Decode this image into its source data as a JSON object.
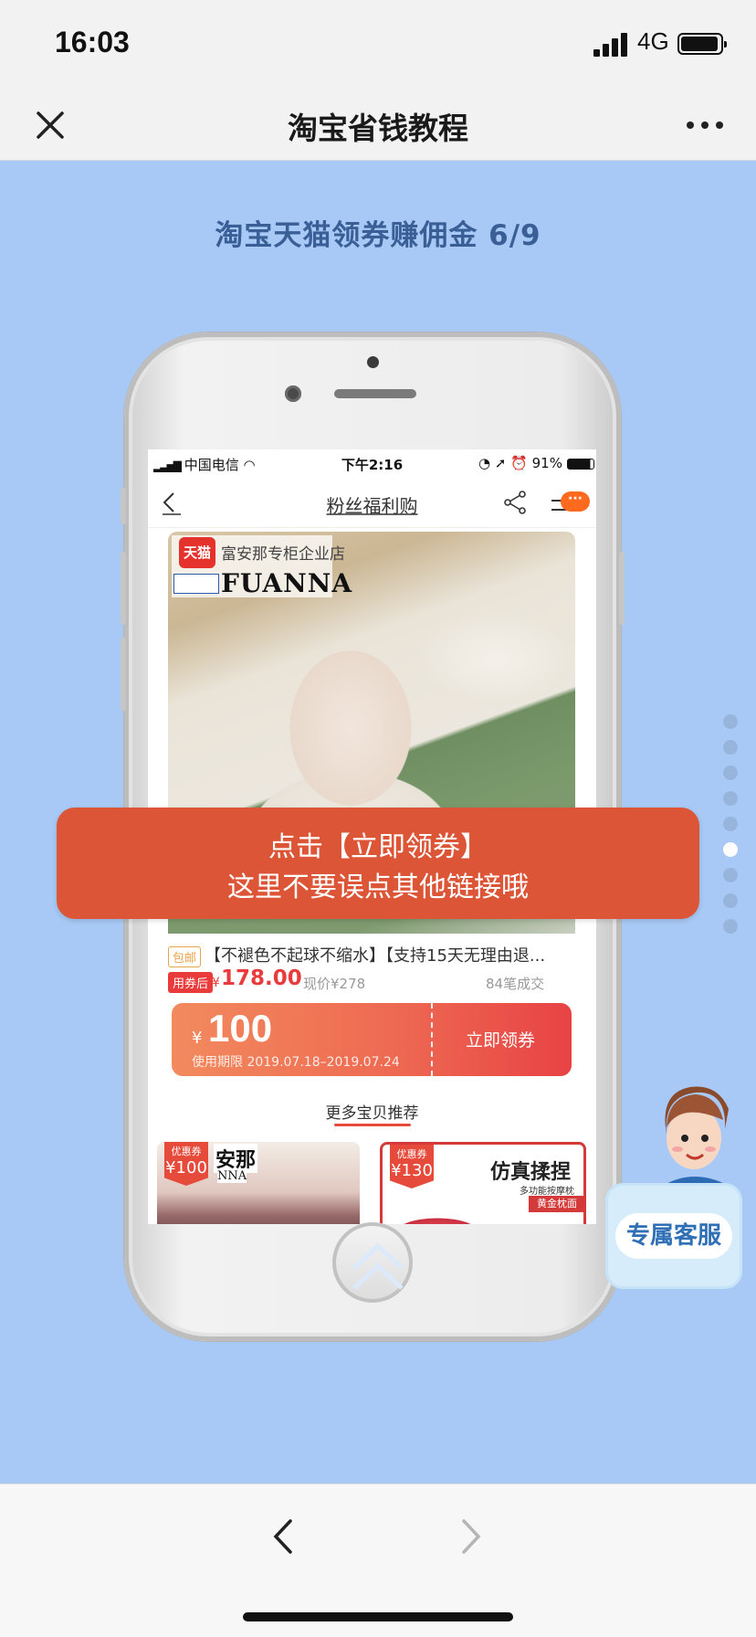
{
  "status_bar": {
    "time": "16:03",
    "network": "4G"
  },
  "nav": {
    "title": "淘宝省钱教程"
  },
  "step_title": "淘宝天猫领券赚佣金 6/9",
  "inner": {
    "status": {
      "carrier": "中国电信",
      "time": "下午2:16",
      "battery": "91%"
    },
    "nav_title": "粉丝福利购",
    "badge": "···",
    "shop": {
      "tmall_logo": "天猫",
      "name": "富安那专柜企业店",
      "brand": "FUANNA"
    },
    "product": {
      "tag": "包邮",
      "name": "【不褪色不起球不缩水】【支持15天无理由退...",
      "after_label": "用券后",
      "currency": "¥",
      "price": "178.00",
      "orig_price": "现价¥278",
      "sold": "84笔成交"
    },
    "coupon": {
      "currency": "¥",
      "amount": "100",
      "validity": "使用期限 2019.07.18–2019.07.24",
      "button": "立即领券"
    },
    "more_title": "更多宝贝推荐",
    "recommendations": [
      {
        "badge_label": "优惠券",
        "badge_value": "¥100",
        "text": "安那",
        "sub": "NNA"
      },
      {
        "badge_label": "优惠券",
        "badge_value": "¥130",
        "text": "仿真揉捏",
        "sub": "多功能按摩枕",
        "badge2": "黄金枕面"
      }
    ]
  },
  "tip": {
    "line1": "点击【立即领券】",
    "line2": "这里不要误点其他链接哦"
  },
  "pager": {
    "total": 9,
    "active": 6
  },
  "assistant": {
    "label": "专属客服"
  },
  "colors": {
    "background": "#a8c9f6",
    "tip": "#dc5536",
    "accent_red": "#e93b3b",
    "title_blue": "#3a5f96"
  }
}
